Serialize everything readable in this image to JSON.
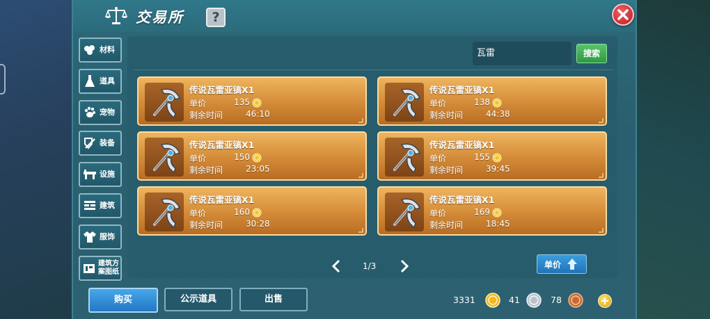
{
  "window": {
    "title": "交易所",
    "help": "?"
  },
  "sidebar": {
    "items": [
      {
        "label": "材料",
        "icon": "cotton-icon"
      },
      {
        "label": "道具",
        "icon": "flask-icon"
      },
      {
        "label": "宠物",
        "icon": "paw-icon"
      },
      {
        "label": "装备",
        "icon": "equipment-icon"
      },
      {
        "label": "设施",
        "icon": "facility-icon"
      },
      {
        "label": "建筑",
        "icon": "wall-icon"
      },
      {
        "label": "服饰",
        "icon": "shirt-icon"
      },
      {
        "label": "建筑方案图纸",
        "icon": "blueprint-icon"
      }
    ]
  },
  "search": {
    "value": "瓦雷",
    "button_label": "搜索"
  },
  "listing_common": {
    "price_label": "单价",
    "time_label": "剩余时间"
  },
  "listings": [
    {
      "name": "传说瓦雷亚镐X1",
      "price": "135",
      "time": "46:10"
    },
    {
      "name": "传说瓦雷亚镐X1",
      "price": "138",
      "time": "44:38"
    },
    {
      "name": "传说瓦雷亚镐X1",
      "price": "150",
      "time": "23:05"
    },
    {
      "name": "传说瓦雷亚镐X1",
      "price": "155",
      "time": "39:45"
    },
    {
      "name": "传说瓦雷亚镐X1",
      "price": "160",
      "time": "30:28"
    },
    {
      "name": "传说瓦雷亚镐X1",
      "price": "169",
      "time": "18:45"
    }
  ],
  "pagination": {
    "label": "1/3"
  },
  "sort": {
    "label": "单价"
  },
  "bottom": {
    "buy_label": "购买",
    "public_label": "公示道具",
    "sell_label": "出售"
  },
  "currencies": {
    "gold": "3331",
    "silver": "41",
    "copper": "78"
  },
  "colors": {
    "card_top": "#eeb45e",
    "card_bottom": "#b96c22",
    "search_button": "#3fae55",
    "buy_button": "#2f8ed6",
    "close_button": "#d63a3f"
  }
}
